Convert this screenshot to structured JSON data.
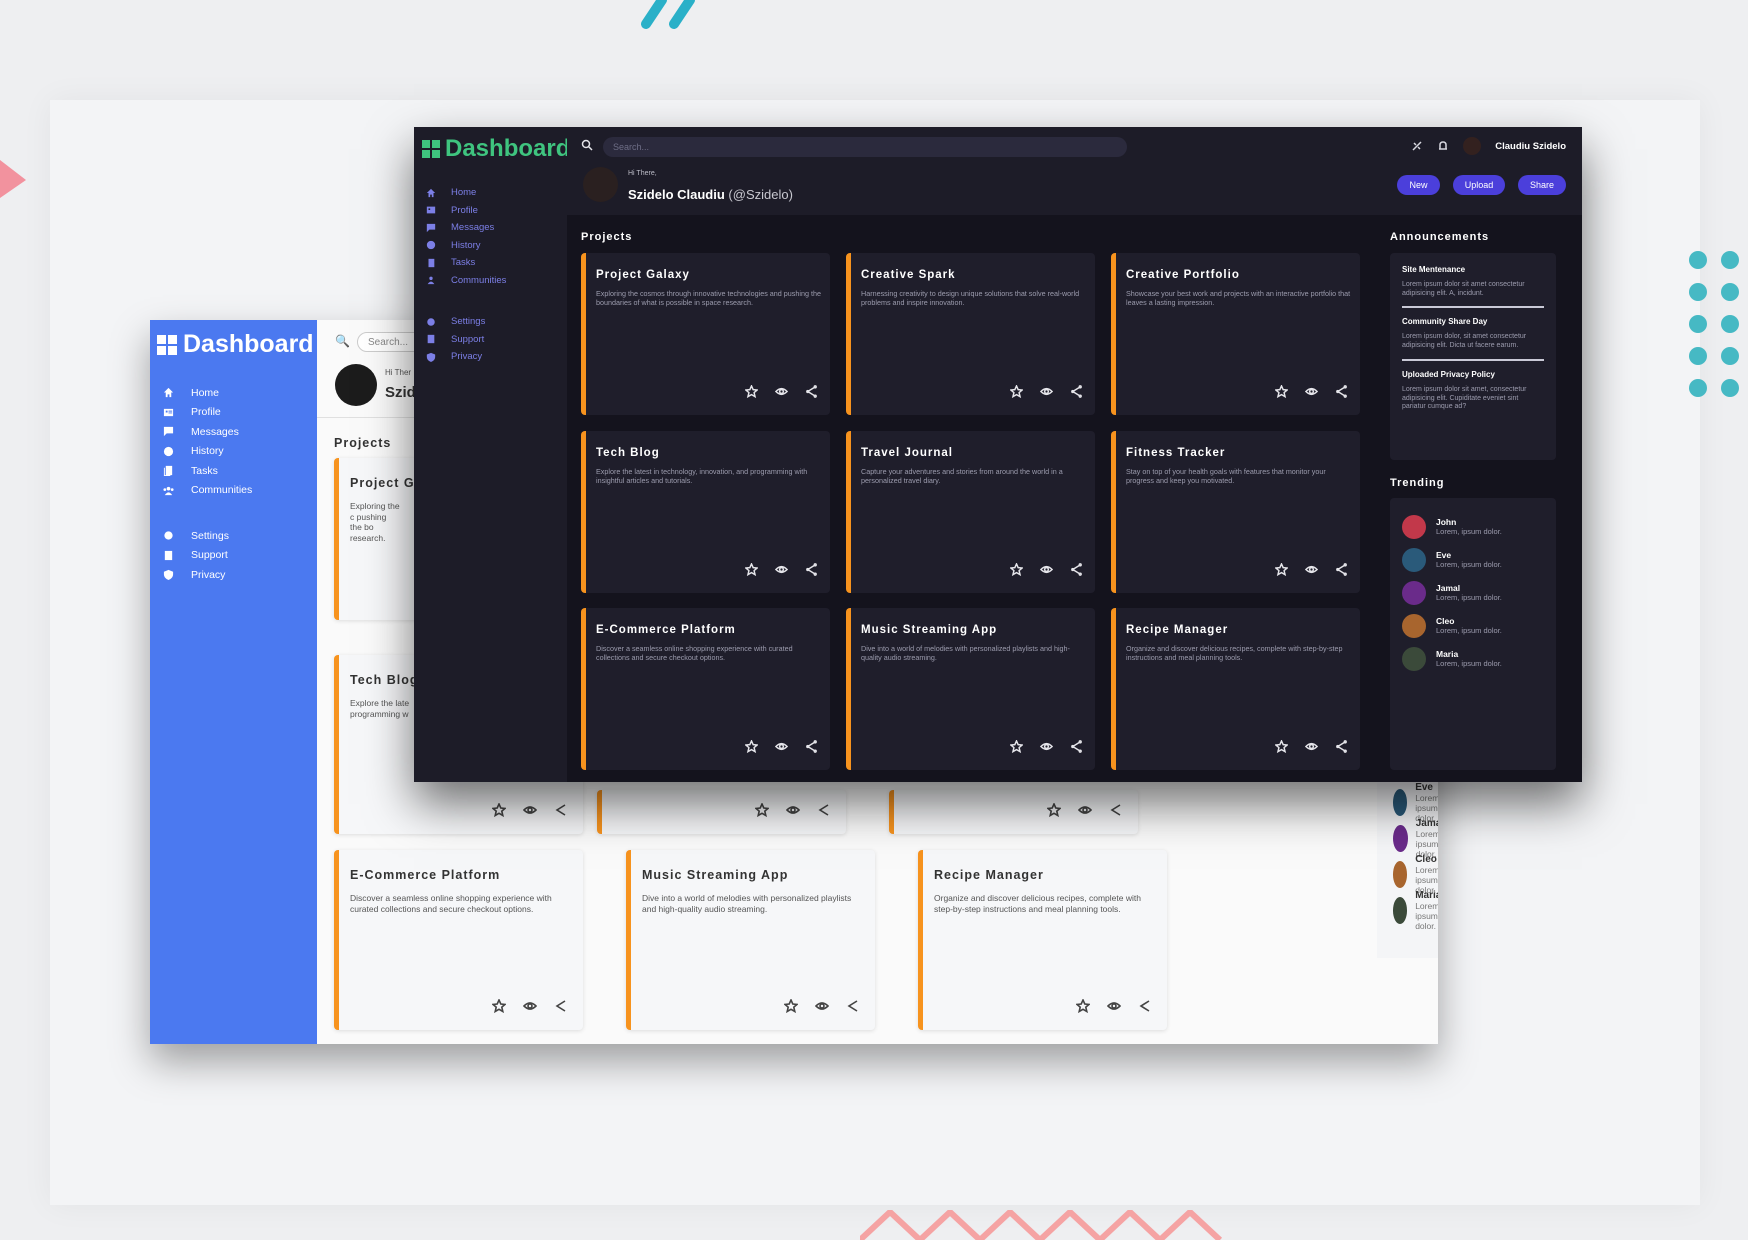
{
  "brand": {
    "title": "Dashboard",
    "light_accent": "#4b79f0",
    "dark_accent": "#3fc47f",
    "card_border": "#f7931e",
    "button_color": "#4b3fdb"
  },
  "nav": {
    "main": [
      {
        "label": "Home",
        "icon": "home-icon"
      },
      {
        "label": "Profile",
        "icon": "profile-icon"
      },
      {
        "label": "Messages",
        "icon": "messages-icon"
      },
      {
        "label": "History",
        "icon": "history-icon"
      },
      {
        "label": "Tasks",
        "icon": "tasks-icon"
      },
      {
        "label": "Communities",
        "icon": "communities-icon"
      }
    ],
    "secondary": [
      {
        "label": "Settings",
        "icon": "gear-icon"
      },
      {
        "label": "Support",
        "icon": "support-icon"
      },
      {
        "label": "Privacy",
        "icon": "shield-icon"
      }
    ]
  },
  "header": {
    "search_placeholder": "Search...",
    "greeting": "Hi There,",
    "name": "Szidelo Claudiu",
    "handle": "(@Szidelo)",
    "light_name_partial": "Szid",
    "light_greeting_partial": "Hi Ther",
    "user_name": "Claudiu Szidelo",
    "buttons": [
      "New",
      "Upload",
      "Share"
    ]
  },
  "projects": {
    "title": "Projects",
    "items": [
      {
        "title": "Project Galaxy",
        "desc": "Exploring the cosmos through innovative technologies and pushing the boundaries of what is possible in space research."
      },
      {
        "title": "Creative Spark",
        "desc": "Harnessing creativity to design unique solutions that solve real-world problems and inspire innovation."
      },
      {
        "title": "Creative Portfolio",
        "desc": "Showcase your best work and projects with an interactive portfolio that leaves a lasting impression."
      },
      {
        "title": "Tech Blog",
        "desc": "Explore the latest in technology, innovation, and programming with insightful articles and tutorials."
      },
      {
        "title": "Travel Journal",
        "desc": "Capture your adventures and stories from around the world in a personalized travel diary."
      },
      {
        "title": "Fitness Tracker",
        "desc": "Stay on top of your health goals with features that monitor your progress and keep you motivated."
      },
      {
        "title": "E-Commerce Platform",
        "desc": "Discover a seamless online shopping experience with curated collections and secure checkout options."
      },
      {
        "title": "Music Streaming App",
        "desc": "Dive into a world of melodies with personalized playlists and high-quality audio streaming."
      },
      {
        "title": "Recipe Manager",
        "desc": "Organize and discover delicious recipes, complete with step-by-step instructions and meal planning tools."
      }
    ],
    "light_partials": {
      "galaxy_title": "Project Ga",
      "galaxy_desc": "Exploring the c pushing the bo research.",
      "blog_desc": "Explore the late programming w"
    }
  },
  "announcements": {
    "title": "Announcements",
    "items": [
      {
        "title": "Site Mentenance",
        "body": "Lorem ipsum dolor sit amet consectetur adipisicing elit. A, incidunt."
      },
      {
        "title": "Community Share Day",
        "body": "Lorem ipsum dolor, sit amet consectetur adipisicing elit. Dicta ut facere earum."
      },
      {
        "title": "Uploaded Privacy Policy",
        "body": "Lorem ipsum dolor sit amet, consectetur adipisicing elit. Cupiditate eveniet sint pariatur cumque ad?"
      }
    ]
  },
  "trending": {
    "title": "Trending",
    "items": [
      {
        "name": "John",
        "text": "Lorem, ipsum dolor.",
        "color": "#c2384a"
      },
      {
        "name": "Eve",
        "text": "Lorem, ipsum dolor.",
        "color": "#2a5a7a"
      },
      {
        "name": "Jamal",
        "text": "Lorem, ipsum dolor.",
        "color": "#6a2b8a"
      },
      {
        "name": "Cleo",
        "text": "Lorem, ipsum dolor.",
        "color": "#a8652e"
      },
      {
        "name": "Maria",
        "text": "Lorem, ipsum dolor.",
        "color": "#3b4a3a"
      }
    ]
  }
}
